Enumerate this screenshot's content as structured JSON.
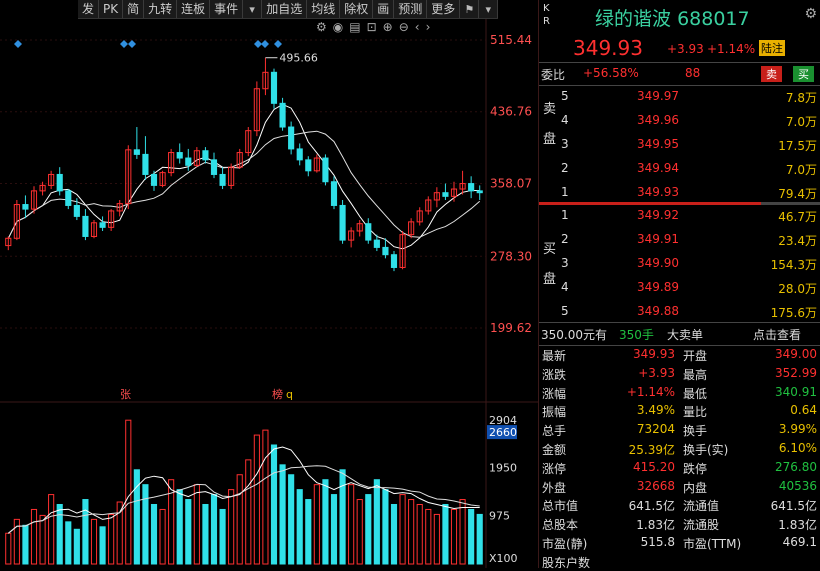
{
  "toolbar": {
    "items": [
      "发",
      "PK",
      "简",
      "九转",
      "连板",
      "事件",
      "加自选",
      "均线",
      "除权",
      "画",
      "预测",
      "更多"
    ],
    "icons": [
      "dropdown-icon",
      "flag-icon",
      "dropdown-icon",
      "settings-icon",
      "eye-icon",
      "basket-icon",
      "zoom-in-icon",
      "zoom-out-icon",
      "chevron-left-icon",
      "chevron-right-icon"
    ]
  },
  "chart": {
    "price_axis": [
      "515.44",
      "436.76",
      "358.07",
      "278.30",
      "199.62"
    ],
    "peak_label": "495.66",
    "vol_axis": [
      "2904",
      "2660",
      "1950",
      "975",
      "X100"
    ],
    "markers": {
      "zhang": "张",
      "bang": "榜",
      "q": "q"
    }
  },
  "chart_data": {
    "type": "candlestick",
    "ylim": [
      199.62,
      515.44
    ],
    "candles": [
      [
        290,
        300,
        285,
        298
      ],
      [
        298,
        340,
        296,
        335
      ],
      [
        335,
        345,
        320,
        330
      ],
      [
        330,
        355,
        325,
        350
      ],
      [
        350,
        360,
        345,
        356
      ],
      [
        356,
        372,
        352,
        368
      ],
      [
        368,
        376,
        345,
        350
      ],
      [
        350,
        352,
        330,
        334
      ],
      [
        334,
        342,
        318,
        322
      ],
      [
        322,
        330,
        296,
        300
      ],
      [
        300,
        318,
        298,
        315
      ],
      [
        315,
        322,
        306,
        310
      ],
      [
        310,
        330,
        306,
        328
      ],
      [
        328,
        340,
        322,
        336
      ],
      [
        336,
        400,
        330,
        395
      ],
      [
        395,
        420,
        385,
        390
      ],
      [
        390,
        410,
        362,
        368
      ],
      [
        368,
        372,
        350,
        356
      ],
      [
        356,
        372,
        354,
        370
      ],
      [
        370,
        396,
        366,
        392
      ],
      [
        392,
        402,
        380,
        386
      ],
      [
        386,
        396,
        372,
        378
      ],
      [
        378,
        398,
        376,
        394
      ],
      [
        394,
        398,
        380,
        384
      ],
      [
        384,
        392,
        364,
        368
      ],
      [
        368,
        376,
        352,
        356
      ],
      [
        356,
        380,
        352,
        376
      ],
      [
        376,
        396,
        374,
        392
      ],
      [
        392,
        420,
        388,
        416
      ],
      [
        416,
        470,
        410,
        462
      ],
      [
        462,
        496,
        455,
        480
      ],
      [
        480,
        484,
        440,
        446
      ],
      [
        446,
        452,
        416,
        420
      ],
      [
        420,
        426,
        390,
        396
      ],
      [
        396,
        402,
        378,
        384
      ],
      [
        384,
        388,
        366,
        372
      ],
      [
        372,
        390,
        370,
        386
      ],
      [
        386,
        390,
        356,
        360
      ],
      [
        360,
        366,
        330,
        334
      ],
      [
        334,
        340,
        292,
        296
      ],
      [
        296,
        310,
        288,
        306
      ],
      [
        306,
        318,
        300,
        314
      ],
      [
        314,
        320,
        292,
        296
      ],
      [
        296,
        302,
        284,
        288
      ],
      [
        288,
        298,
        276,
        280
      ],
      [
        280,
        284,
        262,
        266
      ],
      [
        266,
        306,
        264,
        302
      ],
      [
        302,
        320,
        298,
        316
      ],
      [
        316,
        332,
        312,
        328
      ],
      [
        328,
        344,
        324,
        340
      ],
      [
        340,
        354,
        332,
        348
      ],
      [
        348,
        358,
        340,
        344
      ],
      [
        344,
        360,
        338,
        352
      ],
      [
        352,
        372,
        346,
        358
      ],
      [
        358,
        366,
        342,
        350
      ],
      [
        350,
        356,
        340,
        348
      ]
    ],
    "volumes": [
      620,
      900,
      780,
      1100,
      980,
      1400,
      1200,
      850,
      700,
      1300,
      900,
      750,
      1000,
      1250,
      2900,
      1900,
      1600,
      1200,
      1100,
      1700,
      1500,
      1300,
      1600,
      1200,
      1400,
      1100,
      1500,
      1800,
      2100,
      2600,
      2700,
      2400,
      2000,
      1800,
      1500,
      1300,
      1600,
      1700,
      1400,
      1900,
      1600,
      1300,
      1400,
      1700,
      1500,
      1200,
      1400,
      1300,
      1200,
      1100,
      1000,
      1200,
      1100,
      1300,
      1100,
      1000
    ],
    "ma_note": ""
  },
  "header": {
    "kr": [
      "K",
      "R"
    ],
    "name": "绿的谐波",
    "code": "688017",
    "price": "349.93",
    "change": "+3.93",
    "change_pct": "+1.14%",
    "badge": "陆注"
  },
  "weibi": {
    "label": "委比",
    "value": "+56.58%",
    "diff": "88",
    "sell_btn": "卖",
    "buy_btn": "买"
  },
  "asks": [
    {
      "level": "5",
      "price": "349.97",
      "vol": "7.8万"
    },
    {
      "level": "4",
      "price": "349.96",
      "vol": "7.0万"
    },
    {
      "level": "3",
      "price": "349.95",
      "vol": "17.5万"
    },
    {
      "level": "2",
      "price": "349.94",
      "vol": "7.0万"
    },
    {
      "level": "1",
      "price": "349.93",
      "vol": "79.4万"
    }
  ],
  "bids": [
    {
      "level": "1",
      "price": "349.92",
      "vol": "46.7万"
    },
    {
      "level": "2",
      "price": "349.91",
      "vol": "23.4万"
    },
    {
      "level": "3",
      "price": "349.90",
      "vol": "154.3万"
    },
    {
      "level": "4",
      "price": "349.89",
      "vol": "28.0万"
    },
    {
      "level": "5",
      "price": "349.88",
      "vol": "175.6万"
    }
  ],
  "ask_side_label": [
    "卖",
    "盘"
  ],
  "bid_side_label": [
    "买",
    "盘"
  ],
  "big_order": {
    "price": "350.00元有",
    "qty": "350手",
    "label": "大卖单",
    "link": "点击查看"
  },
  "stats": [
    {
      "l1": "最新",
      "v1": "349.93",
      "c1": "red",
      "l2": "开盘",
      "v2": "349.00",
      "c2": "red"
    },
    {
      "l1": "涨跌",
      "v1": "+3.93",
      "c1": "red",
      "l2": "最高",
      "v2": "352.99",
      "c2": "red"
    },
    {
      "l1": "涨幅",
      "v1": "+1.14%",
      "c1": "red",
      "l2": "最低",
      "v2": "340.91",
      "c2": "grn"
    },
    {
      "l1": "振幅",
      "v1": "3.49%",
      "c1": "yel",
      "l2": "量比",
      "v2": "0.64",
      "c2": "yel"
    },
    {
      "l1": "总手",
      "v1": "73204",
      "c1": "yel",
      "l2": "换手",
      "v2": "3.99%",
      "c2": "yel"
    },
    {
      "l1": "金额",
      "v1": "25.39亿",
      "c1": "yel",
      "l2": "换手(实)",
      "v2": "6.10%",
      "c2": "yel"
    },
    {
      "l1": "涨停",
      "v1": "415.20",
      "c1": "red",
      "l2": "跌停",
      "v2": "276.80",
      "c2": "grn"
    },
    {
      "l1": "外盘",
      "v1": "32668",
      "c1": "red",
      "l2": "内盘",
      "v2": "40536",
      "c2": "grn"
    },
    {
      "l1": "总市值",
      "v1": "641.5亿",
      "c1": "wht",
      "l2": "流通值",
      "v2": "641.5亿",
      "c2": "wht"
    },
    {
      "l1": "总股本",
      "v1": "1.83亿",
      "c1": "wht",
      "l2": "流通股",
      "v2": "1.83亿",
      "c2": "wht"
    },
    {
      "l1": "市盈(静)",
      "v1": "515.8",
      "c1": "wht",
      "l2": "市盈(TTM)",
      "v2": "469.1",
      "c2": "wht"
    },
    {
      "l1": "股东户数",
      "v1": "",
      "c1": "wht",
      "l2": "",
      "v2": "",
      "c2": "wht"
    }
  ],
  "colors": {
    "up": "#ff3030",
    "down": "#30e0e8",
    "ma1": "#ffffff",
    "ma2": "#e8e8e8",
    "accent": "#3ad0a0"
  }
}
